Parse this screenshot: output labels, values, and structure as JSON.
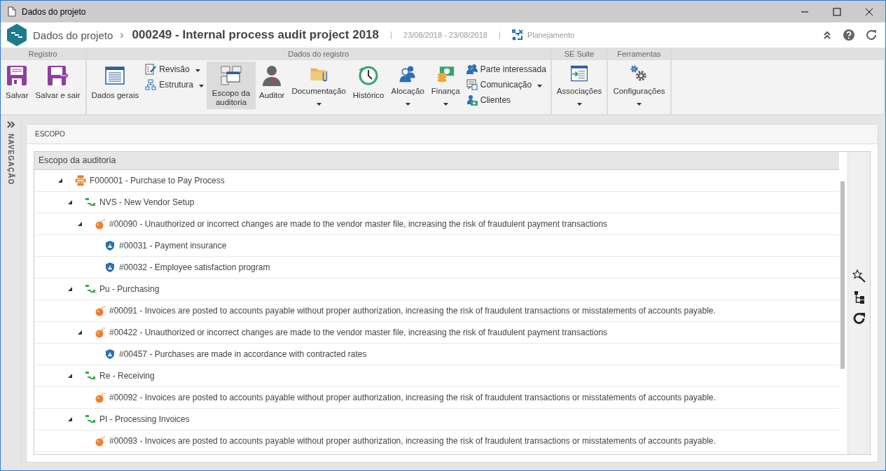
{
  "window": {
    "title": "Dados do projeto"
  },
  "header": {
    "breadcrumb": "Dados do projeto",
    "separator": "›",
    "title": "000249 - Internal process audit project 2018",
    "period": "23/08/2018 - 23/08/2018",
    "stage": "Planejamento"
  },
  "ribbon": {
    "groups": [
      {
        "label": "Registro",
        "items": [
          {
            "kind": "large",
            "label": "Salvar",
            "dropdown": false,
            "selected": false
          },
          {
            "kind": "large",
            "label": "Salvar e sair",
            "dropdown": false,
            "selected": false
          }
        ]
      },
      {
        "label": "Dados do registro",
        "items": [
          {
            "kind": "large",
            "label": "Dados gerais",
            "dropdown": false,
            "selected": false
          },
          {
            "kind": "stack",
            "items": [
              {
                "label": "Revisão",
                "dropdown": true
              },
              {
                "label": "Estrutura",
                "dropdown": true
              }
            ]
          },
          {
            "kind": "large",
            "label": "Escopo da auditoria",
            "dropdown": false,
            "selected": true
          },
          {
            "kind": "large",
            "label": "Auditor",
            "dropdown": false,
            "selected": false
          },
          {
            "kind": "large",
            "label": "Documentação",
            "dropdown": true,
            "selected": false
          },
          {
            "kind": "large",
            "label": "Histórico",
            "dropdown": false,
            "selected": false
          },
          {
            "kind": "large",
            "label": "Alocação",
            "dropdown": true,
            "selected": false
          },
          {
            "kind": "large",
            "label": "Finança",
            "dropdown": true,
            "selected": false
          },
          {
            "kind": "stack",
            "items": [
              {
                "label": "Parte interessada",
                "dropdown": false
              },
              {
                "label": "Comunicação",
                "dropdown": true
              },
              {
                "label": "Clientes",
                "dropdown": false
              }
            ]
          }
        ]
      },
      {
        "label": "SE Suite",
        "items": [
          {
            "kind": "large",
            "label": "Associações",
            "dropdown": true,
            "selected": false
          }
        ]
      },
      {
        "label": "Ferramentas",
        "items": [
          {
            "kind": "large",
            "label": "Configurações",
            "dropdown": true,
            "selected": false
          }
        ]
      }
    ]
  },
  "navigation": {
    "label": "NAVEGAÇÃO"
  },
  "scope": {
    "title": "ESCOPO",
    "tree": {
      "column": "Escopo da auditoria",
      "items": [
        {
          "kind": "process",
          "text": "F000001 - Purchase to Pay Process",
          "expanded": true,
          "children": [
            {
              "kind": "activity",
              "text": "NVS - New Vendor Setup",
              "expanded": true,
              "children": [
                {
                  "kind": "risk",
                  "text": "#00090 - Unauthorized or incorrect changes are made to the vendor master file, increasing the risk of fraudulent payment transactions",
                  "expanded": true,
                  "children": [
                    {
                      "kind": "control",
                      "text": "#00031 - Payment insurance"
                    },
                    {
                      "kind": "control",
                      "text": "#00032 - Employee satisfaction program"
                    }
                  ]
                }
              ]
            },
            {
              "kind": "activity",
              "text": "Pu - Purchasing",
              "expanded": true,
              "children": [
                {
                  "kind": "risk",
                  "text": "#00091 - Invoices are posted to accounts payable without proper authorization, increasing the risk of fraudulent transactions or misstatements of accounts payable."
                },
                {
                  "kind": "risk",
                  "text": "#00422 - Unauthorized or incorrect changes are made to the vendor master file, increasing the risk of fraudulent payment transactions",
                  "expanded": true,
                  "children": [
                    {
                      "kind": "control",
                      "text": "#00457 - Purchases are made in accordance with contracted rates"
                    }
                  ]
                }
              ]
            },
            {
              "kind": "activity",
              "text": "Re - Receiving",
              "expanded": true,
              "children": [
                {
                  "kind": "risk",
                  "text": "#00092 - Invoices are posted to accounts payable without proper authorization, increasing the risk of fraudulent transactions or misstatements of accounts payable."
                }
              ]
            },
            {
              "kind": "activity",
              "text": "PI - Processing Invoices",
              "expanded": true,
              "children": [
                {
                  "kind": "risk",
                  "text": "#00093 - Invoices are posted to accounts payable without proper authorization, increasing the risk of fraudulent transactions or misstatements of accounts payable."
                }
              ]
            }
          ]
        }
      ]
    }
  }
}
